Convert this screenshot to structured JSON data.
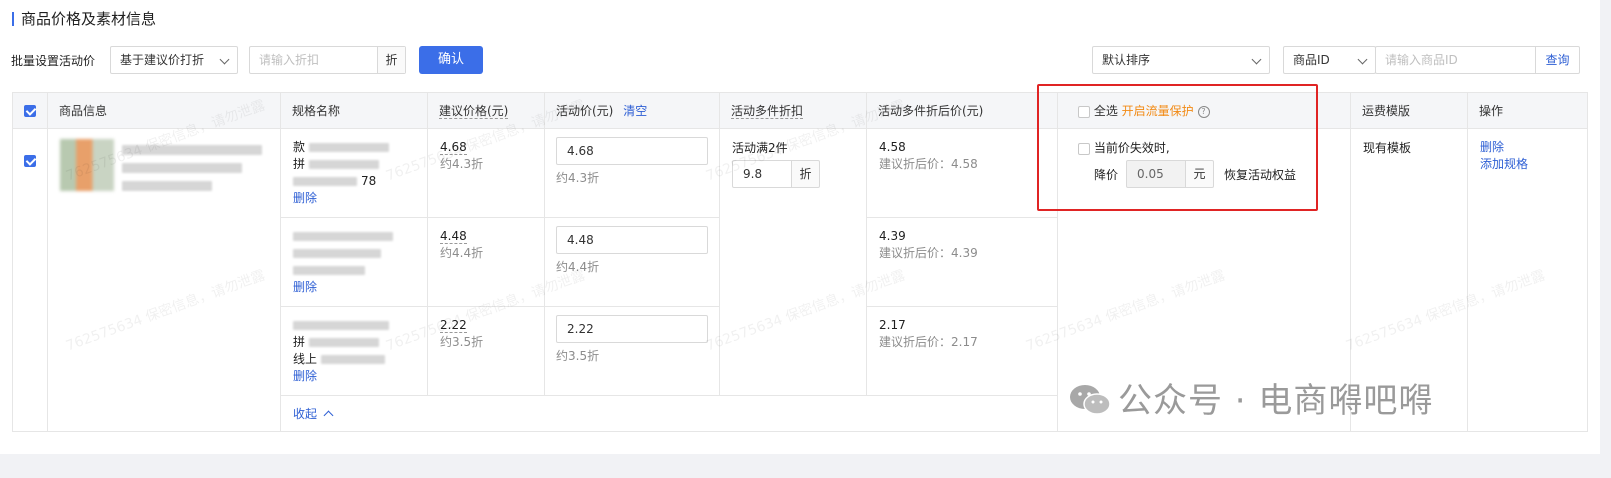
{
  "section_title": "商品价格及素材信息",
  "toolbar": {
    "batch_label": "批量设置活动价",
    "mode_select": "基于建议价打折",
    "discount_placeholder": "请输入折扣",
    "discount_unit": "折",
    "confirm": "确认",
    "sort_select": "默认排序",
    "search_field_select": "商品ID",
    "search_placeholder": "请输入商品ID",
    "search_btn": "查询"
  },
  "table": {
    "headers": {
      "product": "商品信息",
      "spec": "规格名称",
      "suggested": "建议价格(元)",
      "activity": "活动价(元)",
      "clear": "清空",
      "multi": "活动多件折扣",
      "multi_after": "活动多件折后价(元)",
      "select_all": "全选",
      "traffic": "开启流量保护",
      "help": "?",
      "shipping": "运费模版",
      "ops": "操作"
    },
    "rows": [
      {
        "spec_line1": "款",
        "spec_line2": "拼",
        "spec_line3": "78",
        "delete": "删除",
        "suggested": "4.68",
        "suggested_disc": "约4.3折",
        "activity_value": "4.68",
        "activity_disc": "约4.3折",
        "after": "4.58",
        "after_hint": "建议折后价：4.58"
      },
      {
        "spec_line1": "",
        "spec_line2": "",
        "spec_line3": "",
        "delete": "删除",
        "suggested": "4.48",
        "suggested_disc": "约4.4折",
        "activity_value": "4.48",
        "activity_disc": "约4.4折",
        "after": "4.39",
        "after_hint": "建议折后价：4.39"
      },
      {
        "spec_line1": "",
        "spec_line2": "拼",
        "spec_line3": "线上",
        "delete": "删除",
        "suggested": "2.22",
        "suggested_disc": "约3.5折",
        "activity_value": "2.22",
        "activity_disc": "约3.5折",
        "after": "2.17",
        "after_hint": "建议折后价：2.17"
      }
    ],
    "multi_rule": "活动满2件",
    "multi_value": "9.8",
    "multi_unit": "折",
    "protect": {
      "line1": "当前价失效时,",
      "drop_label": "降价",
      "drop_value": "0.05",
      "drop_unit": "元",
      "restore": "恢复活动权益"
    },
    "shipping_value": "现有模板",
    "ops_delete": "删除",
    "ops_add_spec": "添加规格",
    "collapse": "收起"
  },
  "watermark": "762575634 保密信息，请勿泄露",
  "wechat_mark": "公众号 · 电商嘚吧嘚",
  "colors": {
    "accent": "#3b6ee8",
    "highlight_box": "#e02424",
    "orange": "#f28a14"
  }
}
